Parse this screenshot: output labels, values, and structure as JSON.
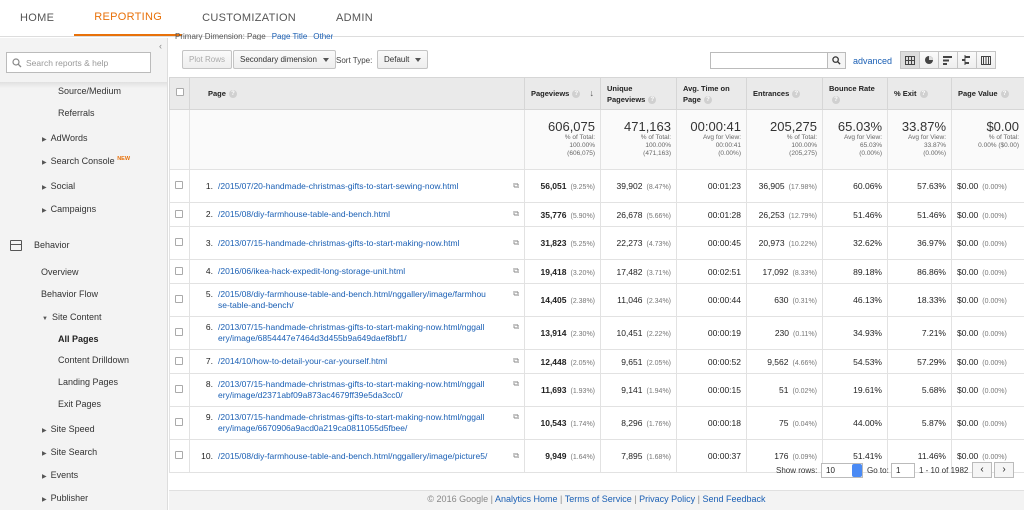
{
  "nav": {
    "tabs": [
      "HOME",
      "REPORTING",
      "CUSTOMIZATION",
      "ADMIN"
    ]
  },
  "sidebar": {
    "search_placeholder": "Search reports & help",
    "collapse": "‹",
    "items": {
      "source_medium": "Source/Medium",
      "referrals": "Referrals",
      "adwords": "AdWords",
      "search_console": "Search Console",
      "search_console_badge": "NEW",
      "social": "Social",
      "campaigns": "Campaigns",
      "behavior": "Behavior",
      "overview": "Overview",
      "behavior_flow": "Behavior Flow",
      "site_content": "Site Content",
      "all_pages": "All Pages",
      "content_drilldown": "Content Drilldown",
      "landing_pages": "Landing Pages",
      "exit_pages": "Exit Pages",
      "site_speed": "Site Speed",
      "site_search": "Site Search",
      "events": "Events",
      "publisher": "Publisher"
    }
  },
  "toolbar": {
    "crumb": "Primary Dimension: Page",
    "crumb_link1": "Page Title",
    "crumb_link2": "Other",
    "plot_rows": "Plot Rows",
    "secondary_dimension": "Secondary dimension",
    "sort_type_label": "Sort Type:",
    "sort_type_value": "Default",
    "advanced": "advanced"
  },
  "table": {
    "headers": {
      "page": "Page",
      "pageviews": "Pageviews",
      "unique": "Unique Pageviews",
      "avg_time": "Avg. Time on Page",
      "entrances": "Entrances",
      "bounce": "Bounce Rate",
      "exit": "% Exit",
      "value": "Page Value"
    },
    "totals": {
      "pageviews": {
        "v": "606,075",
        "s1": "% of Total:",
        "s2": "100.00%",
        "s3": "(606,075)"
      },
      "unique": {
        "v": "471,163",
        "s1": "% of Total:",
        "s2": "100.00%",
        "s3": "(471,163)"
      },
      "avg_time": {
        "v": "00:00:41",
        "s1": "Avg for View:",
        "s2": "00:00:41",
        "s3": "(0.00%)"
      },
      "entrances": {
        "v": "205,275",
        "s1": "% of Total:",
        "s2": "100.00%",
        "s3": "(205,275)"
      },
      "bounce": {
        "v": "65.03%",
        "s1": "Avg for View:",
        "s2": "65.03%",
        "s3": "(0.00%)"
      },
      "exit": {
        "v": "33.87%",
        "s1": "Avg for View:",
        "s2": "33.87%",
        "s3": "(0.00%)"
      },
      "value": {
        "v": "$0.00",
        "s1": "% of Total:",
        "s2": "0.00% ($0.00)",
        "s3": ""
      }
    },
    "rows": [
      {
        "n": "1.",
        "page": "/2015/07/20-handmade-christmas-gifts-to-start-sewing-now.html",
        "pv": "56,051",
        "pvp": "(9.25%)",
        "up": "39,902",
        "upp": "(8.47%)",
        "time": "00:01:23",
        "ent": "36,905",
        "entp": "(17.98%)",
        "br": "60.06%",
        "ex": "57.63%",
        "val": "$0.00",
        "valp": "(0.00%)"
      },
      {
        "n": "2.",
        "page": "/2015/08/diy-farmhouse-table-and-bench.html",
        "pv": "35,776",
        "pvp": "(5.90%)",
        "up": "26,678",
        "upp": "(5.66%)",
        "time": "00:01:28",
        "ent": "26,253",
        "entp": "(12.79%)",
        "br": "51.46%",
        "ex": "51.46%",
        "val": "$0.00",
        "valp": "(0.00%)"
      },
      {
        "n": "3.",
        "page": "/2013/07/15-handmade-christmas-gifts-to-start-making-now.html",
        "pv": "31,823",
        "pvp": "(5.25%)",
        "up": "22,273",
        "upp": "(4.73%)",
        "time": "00:00:45",
        "ent": "20,973",
        "entp": "(10.22%)",
        "br": "32.62%",
        "ex": "36.97%",
        "val": "$0.00",
        "valp": "(0.00%)"
      },
      {
        "n": "4.",
        "page": "/2016/06/ikea-hack-expedit-long-storage-unit.html",
        "pv": "19,418",
        "pvp": "(3.20%)",
        "up": "17,482",
        "upp": "(3.71%)",
        "time": "00:02:51",
        "ent": "17,092",
        "entp": "(8.33%)",
        "br": "89.18%",
        "ex": "86.86%",
        "val": "$0.00",
        "valp": "(0.00%)"
      },
      {
        "n": "5.",
        "page": "/2015/08/diy-farmhouse-table-and-bench.html/nggallery/image/farmhouse-table-and-bench/",
        "pv": "14,405",
        "pvp": "(2.38%)",
        "up": "11,046",
        "upp": "(2.34%)",
        "time": "00:00:44",
        "ent": "630",
        "entp": "(0.31%)",
        "br": "46.13%",
        "ex": "18.33%",
        "val": "$0.00",
        "valp": "(0.00%)"
      },
      {
        "n": "6.",
        "page": "/2013/07/15-handmade-christmas-gifts-to-start-making-now.html/nggallery/image/6854447e7464d3d455b9a649daef8bf1/",
        "pv": "13,914",
        "pvp": "(2.30%)",
        "up": "10,451",
        "upp": "(2.22%)",
        "time": "00:00:19",
        "ent": "230",
        "entp": "(0.11%)",
        "br": "34.93%",
        "ex": "7.21%",
        "val": "$0.00",
        "valp": "(0.00%)"
      },
      {
        "n": "7.",
        "page": "/2014/10/how-to-detail-your-car-yourself.html",
        "pv": "12,448",
        "pvp": "(2.05%)",
        "up": "9,651",
        "upp": "(2.05%)",
        "time": "00:00:52",
        "ent": "9,562",
        "entp": "(4.66%)",
        "br": "54.53%",
        "ex": "57.29%",
        "val": "$0.00",
        "valp": "(0.00%)"
      },
      {
        "n": "8.",
        "page": "/2013/07/15-handmade-christmas-gifts-to-start-making-now.html/nggallery/image/d2371abf09a873ac4679ff39e5da3cc0/",
        "pv": "11,693",
        "pvp": "(1.93%)",
        "up": "9,141",
        "upp": "(1.94%)",
        "time": "00:00:15",
        "ent": "51",
        "entp": "(0.02%)",
        "br": "19.61%",
        "ex": "5.68%",
        "val": "$0.00",
        "valp": "(0.00%)"
      },
      {
        "n": "9.",
        "page": "/2013/07/15-handmade-christmas-gifts-to-start-making-now.html/nggallery/image/6670906a9acd0a219ca0811055d5fbee/",
        "pv": "10,543",
        "pvp": "(1.74%)",
        "up": "8,296",
        "upp": "(1.76%)",
        "time": "00:00:18",
        "ent": "75",
        "entp": "(0.04%)",
        "br": "44.00%",
        "ex": "5.87%",
        "val": "$0.00",
        "valp": "(0.00%)"
      },
      {
        "n": "10.",
        "page": "/2015/08/diy-farmhouse-table-and-bench.html/nggallery/image/picture5/",
        "pv": "9,949",
        "pvp": "(1.64%)",
        "up": "7,895",
        "upp": "(1.68%)",
        "time": "00:00:37",
        "ent": "176",
        "entp": "(0.09%)",
        "br": "51.41%",
        "ex": "11.46%",
        "val": "$0.00",
        "valp": "(0.00%)"
      }
    ]
  },
  "pagination": {
    "show_rows_label": "Show rows:",
    "show_rows_value": "10",
    "goto_label": "Go to:",
    "goto_value": "1",
    "range": "1 - 10 of 1982",
    "prev": "‹",
    "next": "›"
  },
  "footer": {
    "copyright": "© 2016 Google",
    "links": [
      "Analytics Home",
      "Terms of Service",
      "Privacy Policy",
      "Send Feedback"
    ],
    "sep": "|"
  },
  "colors": {
    "accent": "#e8710a",
    "link": "#1a5fb4"
  }
}
